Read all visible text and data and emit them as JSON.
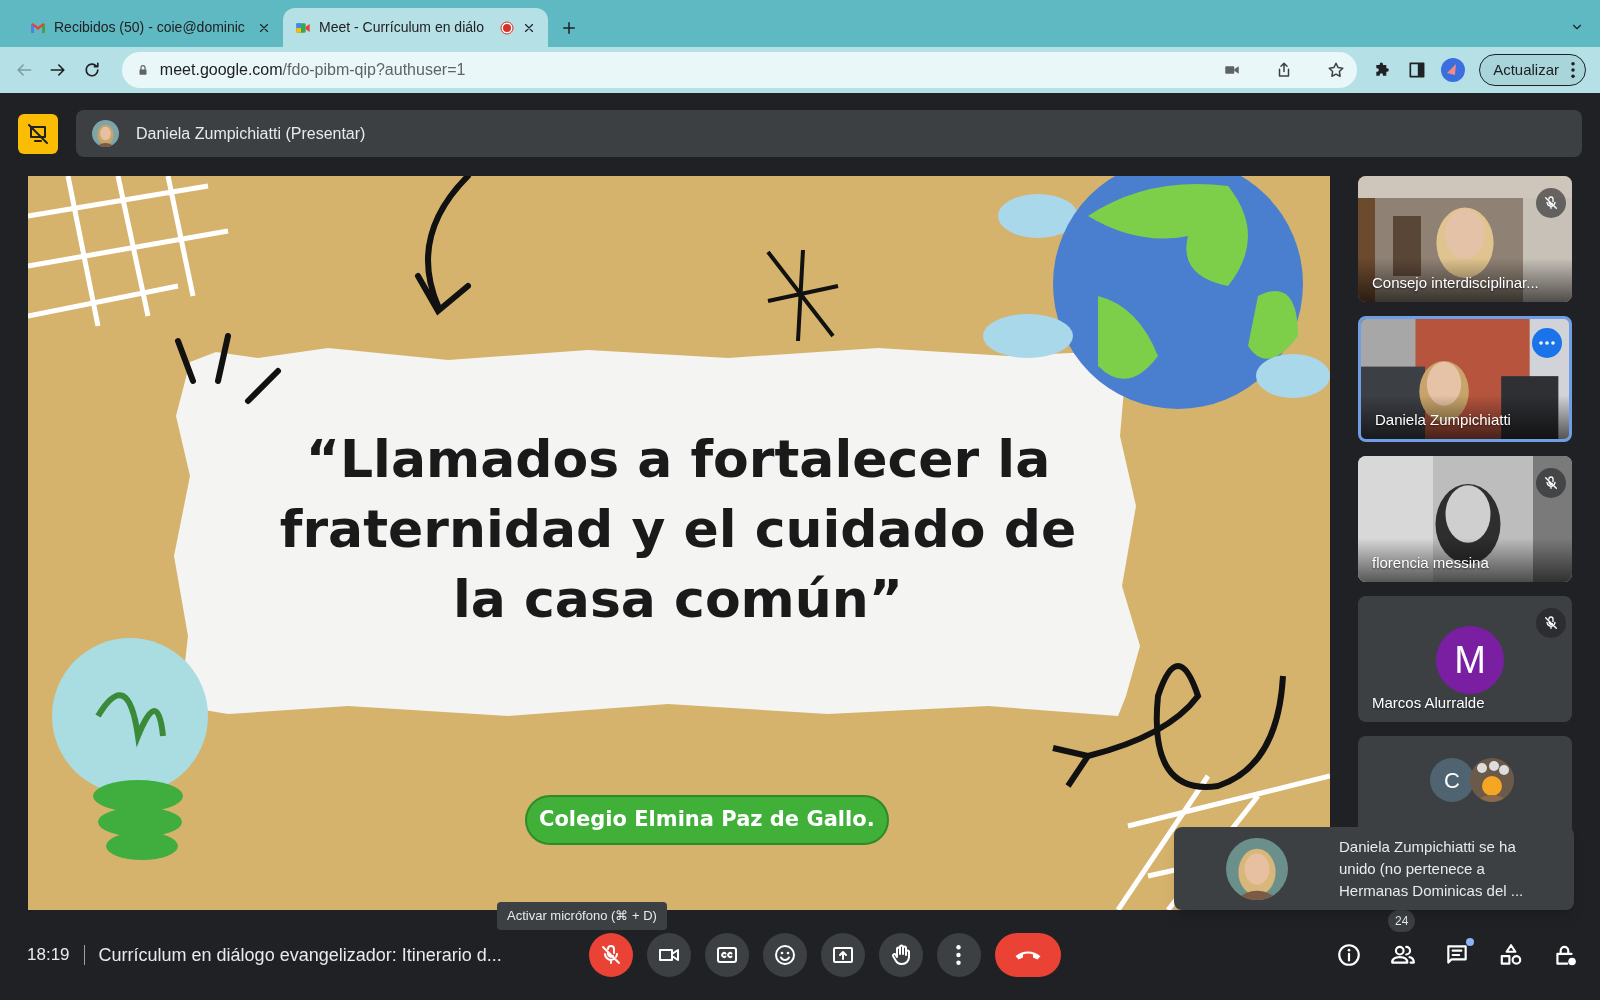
{
  "browser": {
    "tabs": [
      {
        "kind": "gmail",
        "title": "Recibidos (50) - coie@dominic",
        "selected": false,
        "recording": false
      },
      {
        "kind": "meet",
        "title": "Meet - Currículum en diálo",
        "selected": true,
        "recording": true
      }
    ],
    "url": {
      "host": "meet.google.com",
      "path": "/fdo-pibm-qip?authuser=1"
    },
    "update_button": "Actualizar"
  },
  "presenter_bar": {
    "label": "Daniela Zumpichiatti (Presentar)"
  },
  "slide": {
    "title": "“Llamados a fortalecer la fraternidad y el cuidado de la casa común”",
    "footer": "Colegio Elmina Paz de Gallo."
  },
  "participants": [
    {
      "kind": "video",
      "name": "Consejo interdisciplinar...",
      "muted": true,
      "highlighted": false
    },
    {
      "kind": "video",
      "name": "Daniela Zumpichiatti",
      "muted": false,
      "highlighted": true
    },
    {
      "kind": "video",
      "name": "florencia messina",
      "muted": true,
      "highlighted": false
    },
    {
      "kind": "avatar",
      "name": "Marcos Alurralde",
      "initial": "M",
      "color": "#7b1fa2",
      "muted": true,
      "highlighted": false
    },
    {
      "kind": "group",
      "initial": "C"
    }
  ],
  "toast": {
    "message": "Daniela Zumpichiatti se ha unido (no pertenece a Hermanas Dominicas del ..."
  },
  "tooltip": {
    "text": "Activar micrófono (⌘ + D)"
  },
  "footer": {
    "time": "18:19",
    "meeting_title": "Currículum en diálogo evangelizador: Itinerario d..."
  },
  "controls": [
    {
      "kind": "mic",
      "on": false
    },
    {
      "kind": "camera",
      "on": true
    },
    {
      "kind": "captions"
    },
    {
      "kind": "emoji"
    },
    {
      "kind": "present"
    },
    {
      "kind": "hand"
    },
    {
      "kind": "more"
    },
    {
      "kind": "leave"
    }
  ],
  "side_controls": [
    {
      "kind": "info"
    },
    {
      "kind": "people",
      "count": "24"
    },
    {
      "kind": "chat",
      "unread": true
    },
    {
      "kind": "activities"
    },
    {
      "kind": "host"
    }
  ]
}
